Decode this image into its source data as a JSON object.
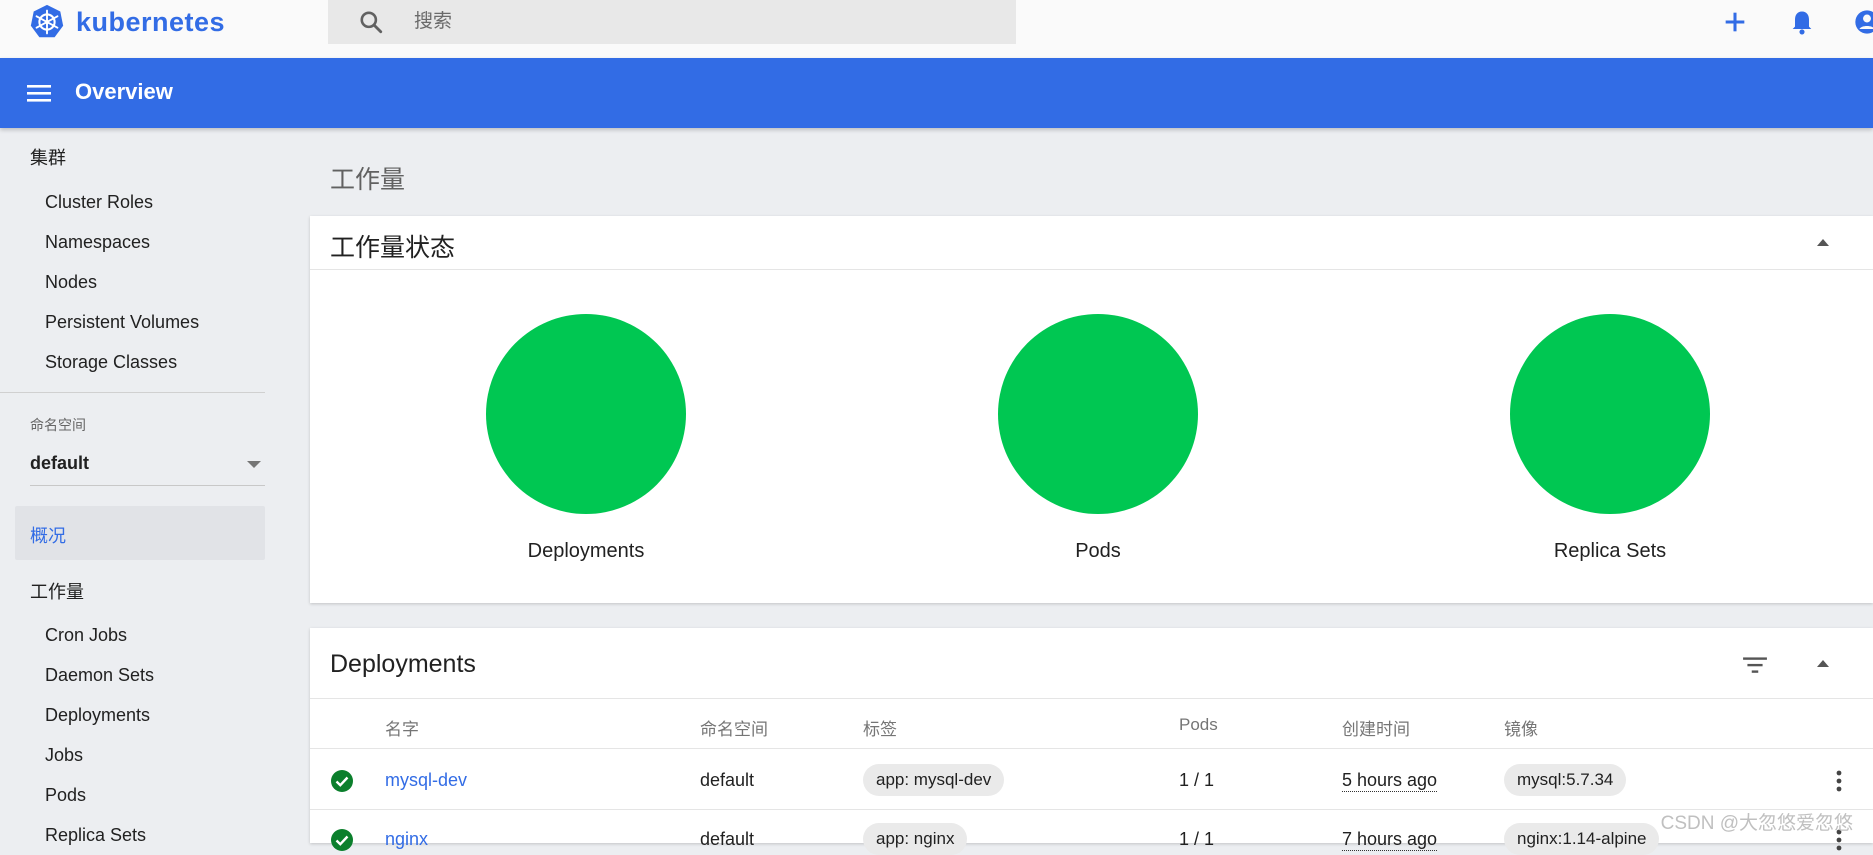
{
  "app": {
    "brand": "kubernetes",
    "brand_color": "#326ce5"
  },
  "search": {
    "placeholder": "搜索"
  },
  "header": {
    "title": "Overview"
  },
  "sidebar": {
    "cluster_section": "集群",
    "cluster_items": [
      "Cluster Roles",
      "Namespaces",
      "Nodes",
      "Persistent Volumes",
      "Storage Classes"
    ],
    "namespace_label": "命名空间",
    "namespace_value": "default",
    "active_item": "概况",
    "workload_section": "工作量",
    "workload_items": [
      "Cron Jobs",
      "Daemon Sets",
      "Deployments",
      "Jobs",
      "Pods",
      "Replica Sets"
    ]
  },
  "main": {
    "page_title": "工作量",
    "status_card": {
      "title": "工作量状态",
      "items": [
        {
          "label": "Deployments",
          "color": "#00c752"
        },
        {
          "label": "Pods",
          "color": "#00c752"
        },
        {
          "label": "Replica Sets",
          "color": "#00c752"
        }
      ]
    },
    "deployments_card": {
      "title": "Deployments",
      "columns": [
        "名字",
        "命名空间",
        "标签",
        "Pods",
        "创建时间",
        "镜像"
      ],
      "rows": [
        {
          "name": "mysql-dev",
          "namespace": "default",
          "label": "app: mysql-dev",
          "pods": "1 / 1",
          "created": "5 hours ago",
          "image": "mysql:5.7.34"
        },
        {
          "name": "nginx",
          "namespace": "default",
          "label": "app: nginx",
          "pods": "1 / 1",
          "created": "7 hours ago",
          "image": "nginx:1.14-alpine"
        }
      ]
    }
  },
  "watermark": "CSDN @大忽悠爱忽悠"
}
